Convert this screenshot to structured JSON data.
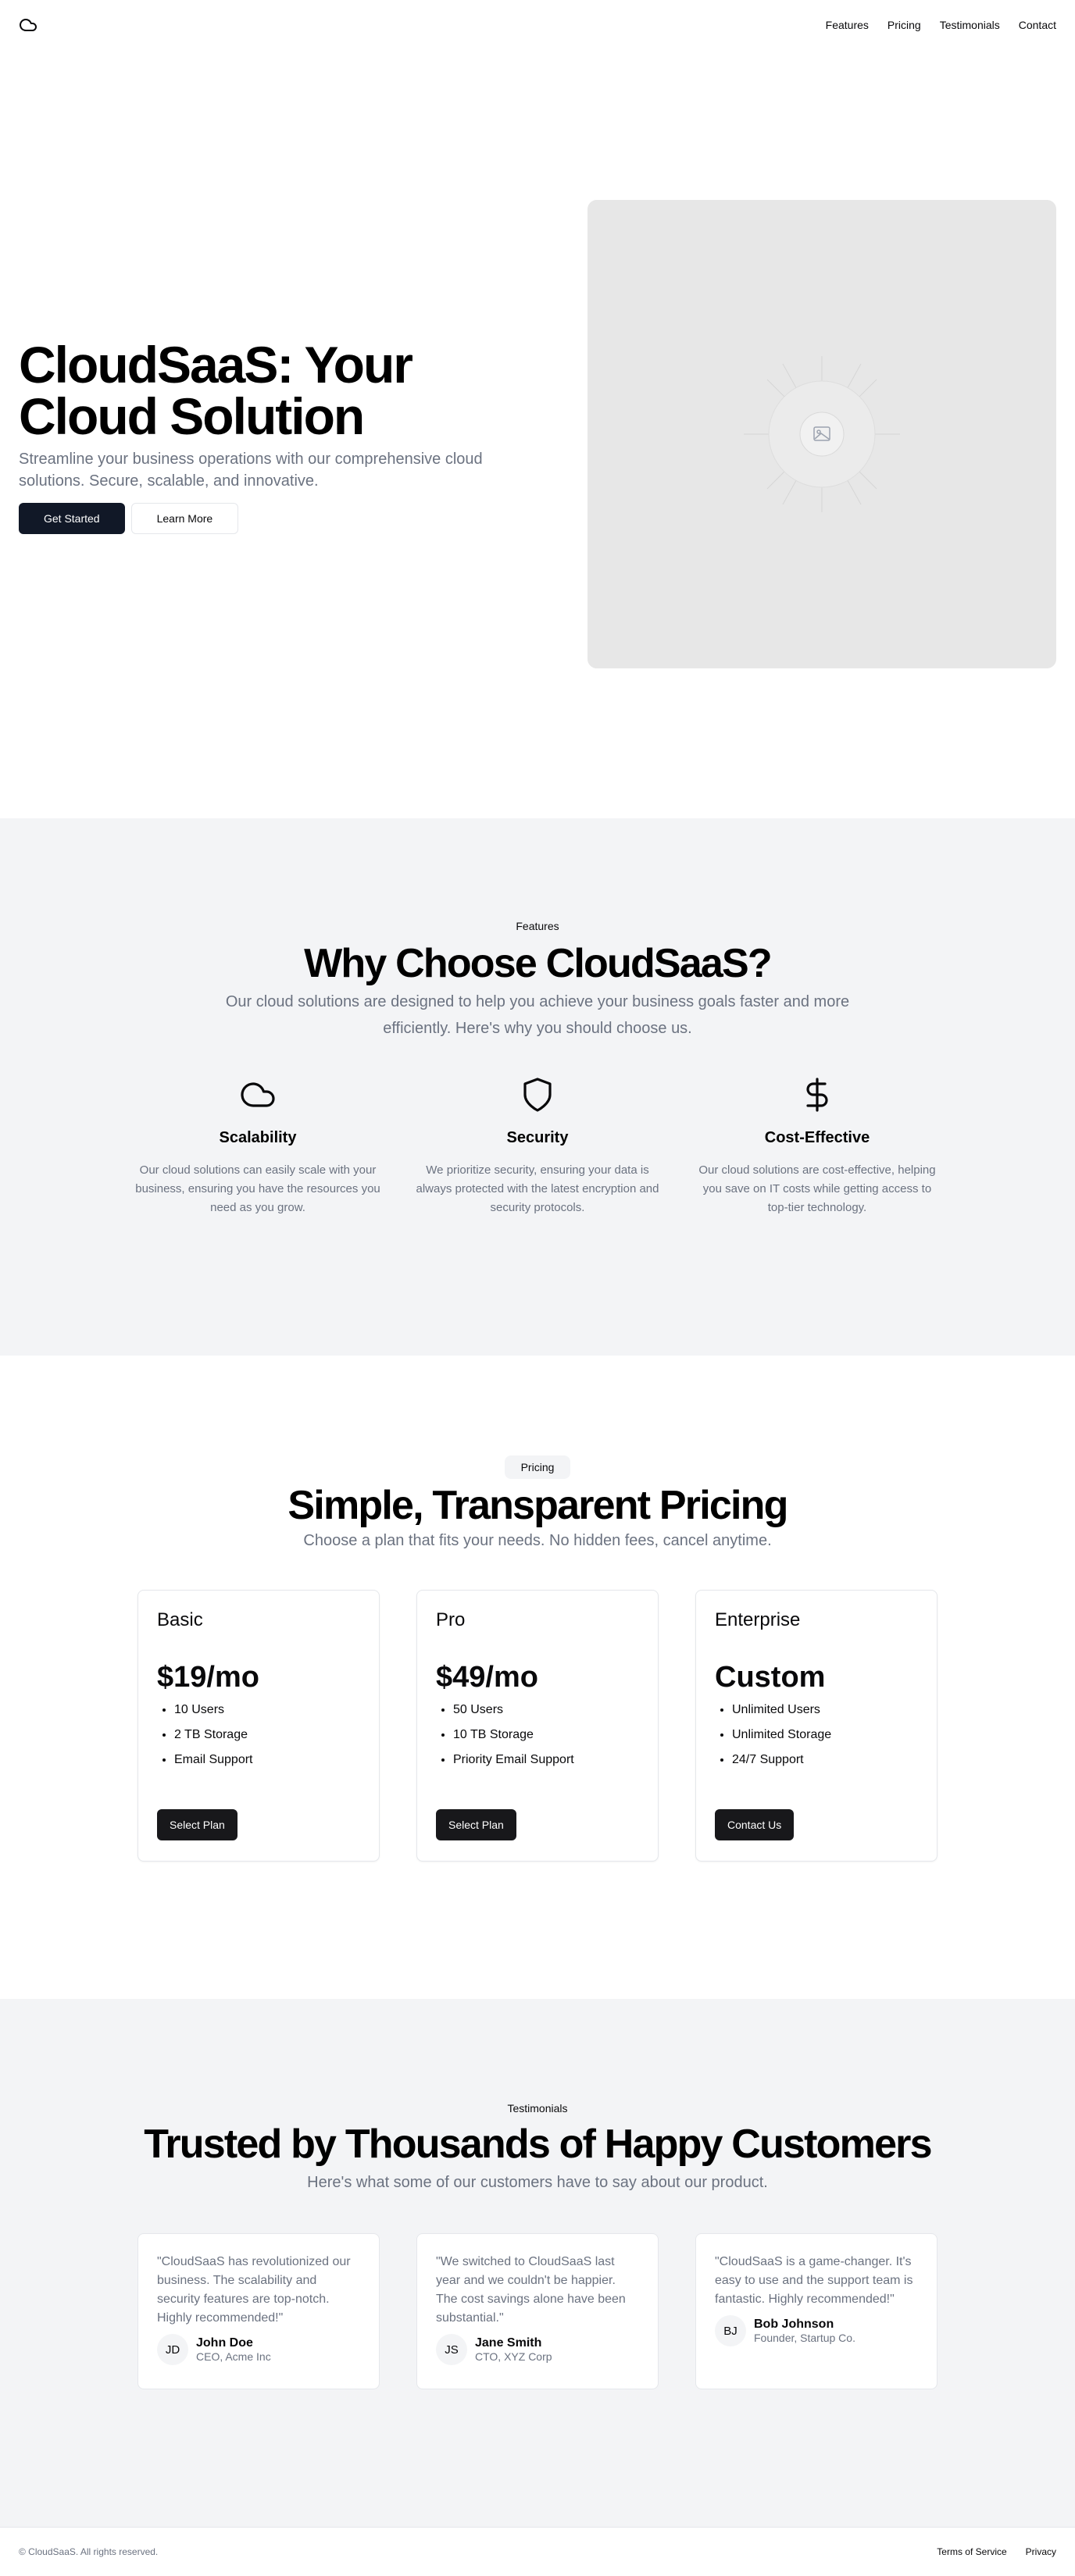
{
  "header": {
    "nav": [
      "Features",
      "Pricing",
      "Testimonials",
      "Contact"
    ]
  },
  "hero": {
    "title": "CloudSaaS: Your Cloud Solution",
    "subtitle": "Streamline your business operations with our comprehensive cloud solutions. Secure, scalable, and innovative.",
    "primary_button": "Get Started",
    "secondary_button": "Learn More",
    "image_icon": "image-placeholder-icon"
  },
  "features": {
    "label": "Features",
    "title": "Why Choose CloudSaaS?",
    "subtitle": "Our cloud solutions are designed to help you achieve your business goals faster and more efficiently. Here's why you should choose us.",
    "items": [
      {
        "icon": "cloud-icon",
        "title": "Scalability",
        "desc": "Our cloud solutions can easily scale with your business, ensuring you have the resources you need as you grow."
      },
      {
        "icon": "shield-icon",
        "title": "Security",
        "desc": "We prioritize security, ensuring your data is always protected with the latest encryption and security protocols."
      },
      {
        "icon": "dollar-icon",
        "title": "Cost-Effective",
        "desc": "Our cloud solutions are cost-effective, helping you save on IT costs while getting access to top-tier technology."
      }
    ]
  },
  "pricing": {
    "label": "Pricing",
    "title": "Simple, Transparent Pricing",
    "subtitle": "Choose a plan that fits your needs. No hidden fees, cancel anytime.",
    "plans": [
      {
        "name": "Basic",
        "price": "$19/mo",
        "features": [
          "10 Users",
          "2 TB Storage",
          "Email Support"
        ],
        "button": "Select Plan"
      },
      {
        "name": "Pro",
        "price": "$49/mo",
        "features": [
          "50 Users",
          "10 TB Storage",
          "Priority Email Support"
        ],
        "button": "Select Plan"
      },
      {
        "name": "Enterprise",
        "price": "Custom",
        "features": [
          "Unlimited Users",
          "Unlimited Storage",
          "24/7 Support"
        ],
        "button": "Contact Us"
      }
    ]
  },
  "testimonials": {
    "label": "Testimonials",
    "title": "Trusted by Thousands of Happy Customers",
    "subtitle": "Here's what some of our customers have to say about our product.",
    "items": [
      {
        "quote": "\"CloudSaaS has revolutionized our business. The scalability and security features are top-notch. Highly recommended!\"",
        "initials": "JD",
        "name": "John Doe",
        "role": "CEO, Acme Inc"
      },
      {
        "quote": "\"We switched to CloudSaaS last year and we couldn't be happier. The cost savings alone have been substantial.\"",
        "initials": "JS",
        "name": "Jane Smith",
        "role": "CTO, XYZ Corp"
      },
      {
        "quote": "\"CloudSaaS is a game-changer. It's easy to use and the support team is fantastic. Highly recommended!\"",
        "initials": "BJ",
        "name": "Bob Johnson",
        "role": "Founder, Startup Co."
      }
    ]
  },
  "footer": {
    "copyright": "© CloudSaaS. All rights reserved.",
    "links": [
      "Terms of Service",
      "Privacy"
    ]
  },
  "colors": {
    "primary": "#111827",
    "muted_text": "#6b7280",
    "section_bg": "#f3f4f6",
    "placeholder_bg": "#e7e7e7"
  }
}
